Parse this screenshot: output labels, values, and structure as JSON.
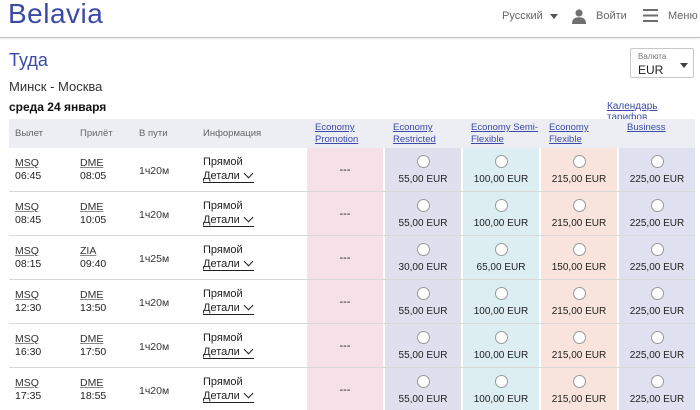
{
  "header": {
    "logo": "Belavia",
    "language": "Русский",
    "login": "Войти",
    "menu": "Меню"
  },
  "page": {
    "title": "Туда",
    "route": "Минск - Москва",
    "date": "среда 24 января",
    "tariff_calendar": "Календарь тарифов"
  },
  "currency": {
    "label": "Валюта",
    "value": "EUR"
  },
  "table": {
    "columns": [
      "Вылет",
      "Прилёт",
      "В пути",
      "Информация"
    ],
    "fare_classes": [
      {
        "line1": "Economy",
        "line2": "Promotion"
      },
      {
        "line1": "Economy",
        "line2": "Restricted"
      },
      {
        "line1": "Economy Semi-",
        "line2": "Flexible"
      },
      {
        "line1": "Economy",
        "line2": "Flexible"
      },
      {
        "line1": "Business",
        "line2": ""
      }
    ],
    "fare_colors": [
      "#f7e1e8",
      "#e0dfee",
      "#ddeef3",
      "#f8e4dc",
      "#e0e1f0"
    ],
    "flights": [
      {
        "dep_code": "MSQ",
        "dep_time": "06:45",
        "arr_code": "DME",
        "arr_time": "08:05",
        "duration": "1ч20м",
        "info": "Прямой",
        "details": "Детали",
        "fares": [
          "---",
          "55,00 EUR",
          "100,00 EUR",
          "215,00 EUR",
          "225,00 EUR"
        ]
      },
      {
        "dep_code": "MSQ",
        "dep_time": "08:45",
        "arr_code": "DME",
        "arr_time": "10:05",
        "duration": "1ч20м",
        "info": "Прямой",
        "details": "Детали",
        "fares": [
          "---",
          "55,00 EUR",
          "100,00 EUR",
          "215,00 EUR",
          "225,00 EUR"
        ]
      },
      {
        "dep_code": "MSQ",
        "dep_time": "08:15",
        "arr_code": "ZIA",
        "arr_time": "09:40",
        "duration": "1ч25м",
        "info": "Прямой",
        "details": "Детали",
        "fares": [
          "---",
          "30,00 EUR",
          "65,00 EUR",
          "150,00 EUR",
          "225,00 EUR"
        ]
      },
      {
        "dep_code": "MSQ",
        "dep_time": "12:30",
        "arr_code": "DME",
        "arr_time": "13:50",
        "duration": "1ч20м",
        "info": "Прямой",
        "details": "Детали",
        "fares": [
          "---",
          "55,00 EUR",
          "100,00 EUR",
          "215,00 EUR",
          "225,00 EUR"
        ]
      },
      {
        "dep_code": "MSQ",
        "dep_time": "16:30",
        "arr_code": "DME",
        "arr_time": "17:50",
        "duration": "1ч20м",
        "info": "Прямой",
        "details": "Детали",
        "fares": [
          "---",
          "55,00 EUR",
          "100,00 EUR",
          "215,00 EUR",
          "225,00 EUR"
        ]
      },
      {
        "dep_code": "MSQ",
        "dep_time": "17:35",
        "arr_code": "DME",
        "arr_time": "18:55",
        "duration": "1ч20м",
        "info": "Прямой",
        "details": "Детали",
        "fares": [
          "---",
          "55,00 EUR",
          "100,00 EUR",
          "215,00 EUR",
          "225,00 EUR"
        ]
      }
    ]
  }
}
